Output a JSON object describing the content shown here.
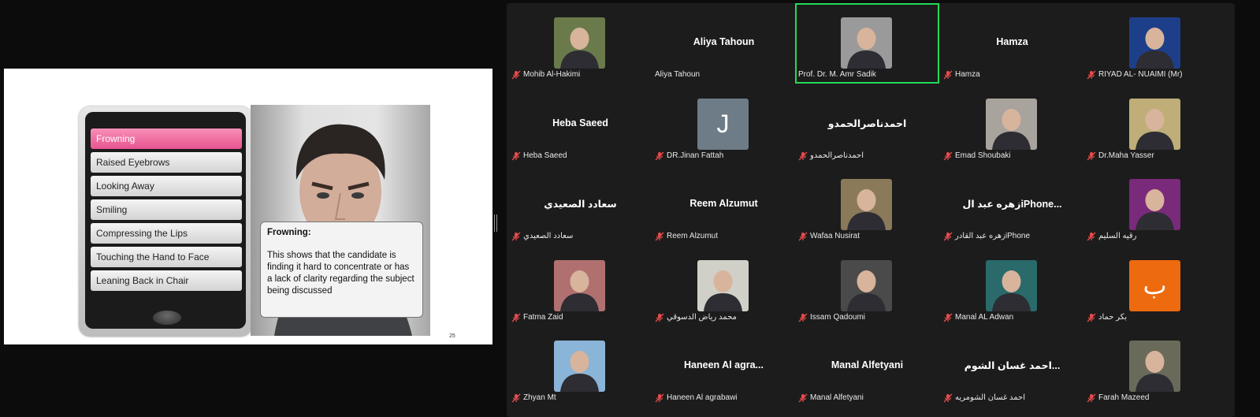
{
  "slide": {
    "menu_items": [
      {
        "label": "Frowning",
        "active": true
      },
      {
        "label": "Raised Eyebrows",
        "active": false
      },
      {
        "label": "Looking Away",
        "active": false
      },
      {
        "label": "Smiling",
        "active": false
      },
      {
        "label": "Compressing the Lips",
        "active": false
      },
      {
        "label": "Touching the Hand to Face",
        "active": false
      },
      {
        "label": "Leaning Back in Chair",
        "active": false
      }
    ],
    "callout_title": "Frowning:",
    "callout_body": "This shows that the candidate is finding it hard to concentrate or has a lack of clarity regarding the subject being discussed",
    "page_number": "25"
  },
  "gallery": {
    "mic_icon": "mic-muted-icon",
    "participants": [
      {
        "name": "Mohib Al-Hakimi",
        "display": "photo",
        "bg": "#6a7a4a"
      },
      {
        "name": "Aliya Tahoun",
        "display": "name",
        "center_name": "Aliya Tahoun",
        "muted": false
      },
      {
        "name": "Prof. Dr. M. Amr Sadik",
        "display": "photo",
        "bg": "#9a9a9a",
        "speaking": true,
        "muted": false
      },
      {
        "name": "Hamza",
        "display": "name",
        "center_name": "Hamza"
      },
      {
        "name": "RIYAD AL- NUAIMI (Mr)",
        "display": "photo",
        "bg": "#1d3f8a"
      },
      {
        "name": "Heba Saeed",
        "display": "name",
        "center_name": "Heba Saeed"
      },
      {
        "name": "DR.Jinan Fattah",
        "display": "letter",
        "letter": "J",
        "bg": "#6d7c87"
      },
      {
        "name": "احمدناصرالحمدو",
        "display": "name",
        "center_name": "احمدناصرالحمدو"
      },
      {
        "name": "Emad Shoubaki",
        "display": "photo",
        "bg": "#a8a39c"
      },
      {
        "name": "Dr.Maha Yasser",
        "display": "photo",
        "bg": "#bfae78"
      },
      {
        "name": "سعادد الصعيدي",
        "display": "name",
        "center_name": "سعادد الصعيدي"
      },
      {
        "name": "Reem Alzumut",
        "display": "name",
        "center_name": "Reem Alzumut"
      },
      {
        "name": "Wafaa Nusirat",
        "display": "photo",
        "bg": "#8a7a5a"
      },
      {
        "name": "زهره عبد القادرiPhone",
        "display": "name",
        "center_name": "زهره عبد الiPhone..."
      },
      {
        "name": "رقيه السليم",
        "display": "photo",
        "bg": "#7a2a7a"
      },
      {
        "name": "Fatma Zaid",
        "display": "photo",
        "bg": "#b07070"
      },
      {
        "name": "محمد رياض الدسوقي",
        "display": "photo",
        "bg": "#d0d0c8"
      },
      {
        "name": "Issam Qadoumi",
        "display": "photo",
        "bg": "#4a4a4a"
      },
      {
        "name": "Manal AL Adwan",
        "display": "photo",
        "bg": "#2a6a6a"
      },
      {
        "name": "بكر حماد",
        "display": "letter",
        "letter": "ب",
        "bg": "#ee6a0e"
      },
      {
        "name": "Zhyan Mt",
        "display": "photo",
        "bg": "#8ab4d8"
      },
      {
        "name": "Haneen Al agrabawi",
        "display": "name",
        "center_name": "Haneen  Al  agra..."
      },
      {
        "name": "Manal Alfetyani",
        "display": "name",
        "center_name": "Manal Alfetyani"
      },
      {
        "name": "احمد غسان الشومريه",
        "display": "name",
        "center_name": "احمد غسان الشوم..."
      },
      {
        "name": "Farah Mazeed",
        "display": "photo",
        "bg": "#6a6a5a"
      }
    ]
  }
}
